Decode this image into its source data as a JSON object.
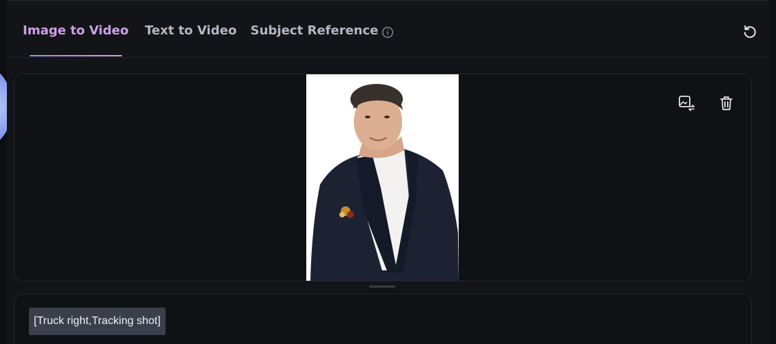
{
  "tabs": [
    {
      "label": "Image to Video",
      "active": true
    },
    {
      "label": "Text to Video",
      "active": false
    },
    {
      "label": "Subject Reference",
      "active": false
    }
  ],
  "icons": {
    "info": "info-icon",
    "reset": "reset-icon",
    "replace_image": "image-replace-icon",
    "delete": "trash-icon"
  },
  "prompt": {
    "camera_tag": "[Truck right,Tracking shot]"
  },
  "colors": {
    "active_tab": "#cf9fe7",
    "inactive_tab": "#b5b8bf",
    "panel_bg": "#131418",
    "chip_bg": "#3a3f4b"
  }
}
